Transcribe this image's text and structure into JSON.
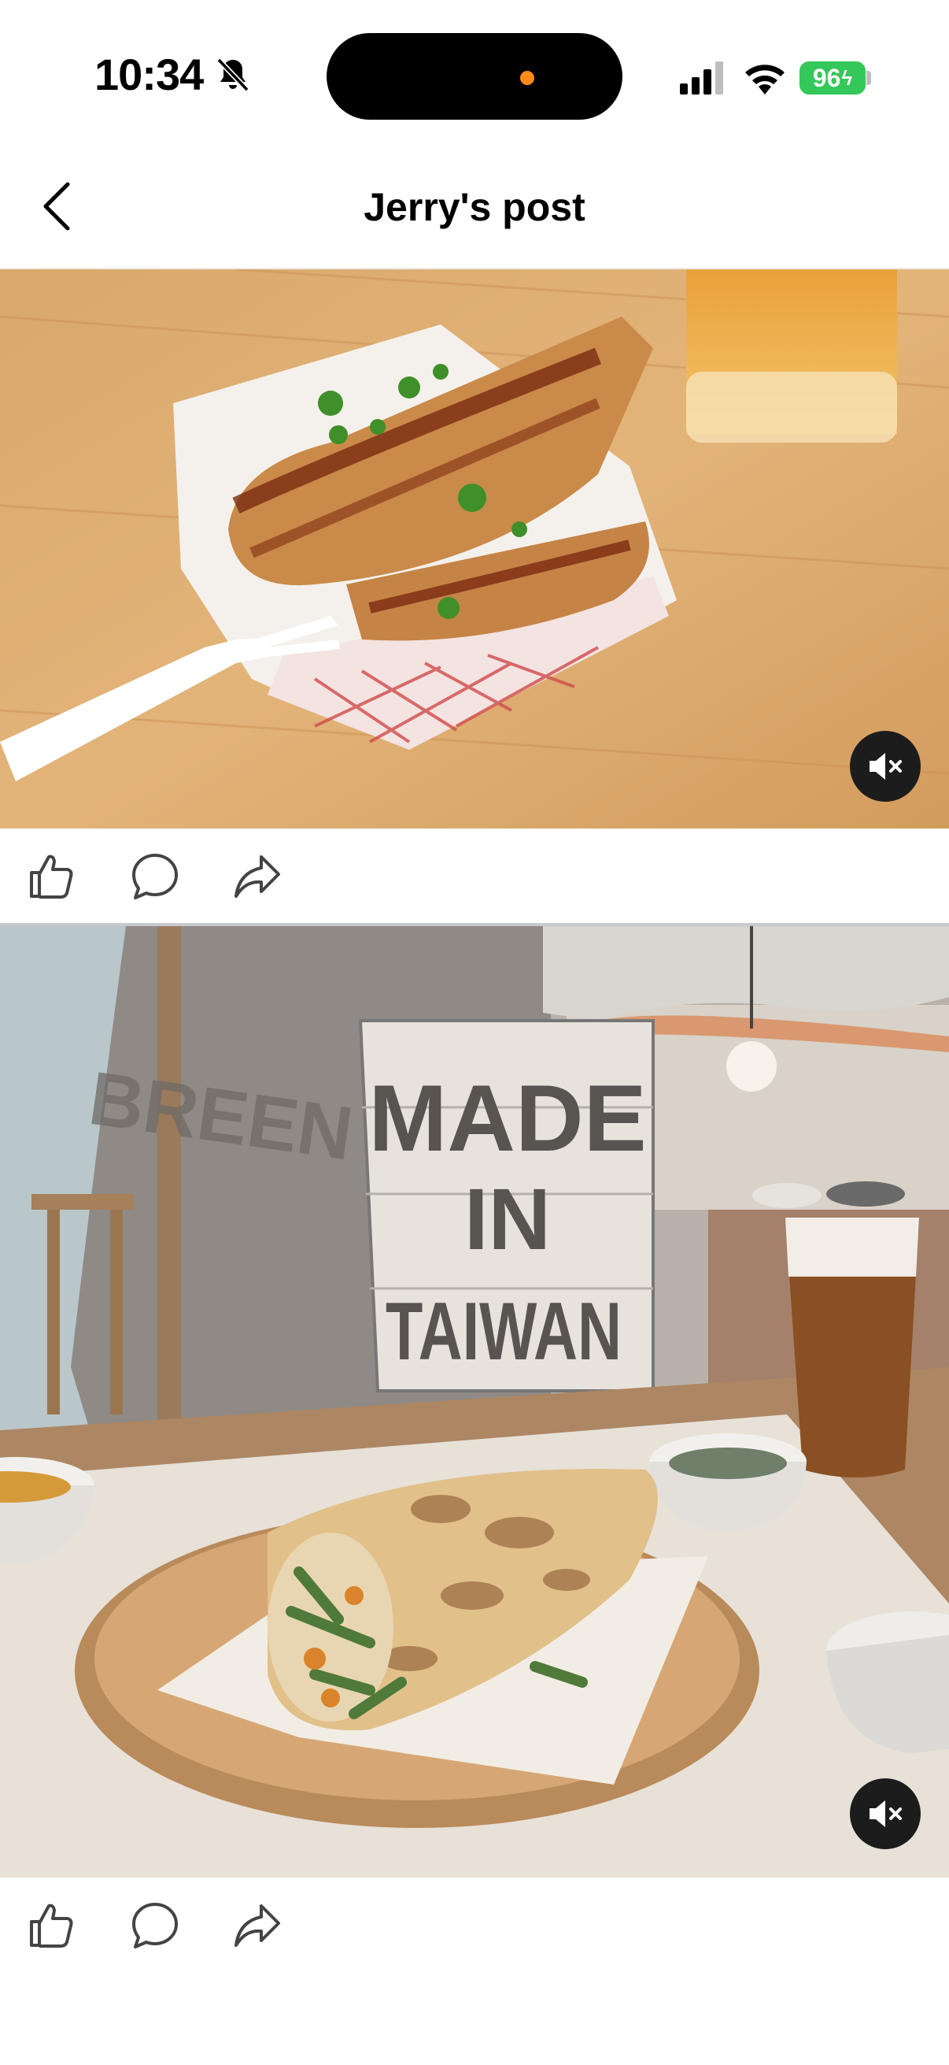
{
  "status_bar": {
    "time": "10:34",
    "battery": "96",
    "icons": [
      "bell-slash-icon",
      "signal-icon",
      "wifi-icon",
      "battery-charging-icon"
    ],
    "battery_color": "#34c759",
    "island_dot_color": "#ff8c1a"
  },
  "header": {
    "title": "Jerry's post",
    "back_icon": "chevron-left-icon"
  },
  "posts": [
    {
      "media_type": "photo",
      "image_description_icon": "food-photo",
      "scene": {
        "sign_text": ""
      },
      "mute_icon": "speaker-muted-icon",
      "actions": [
        "like-icon",
        "comment-icon",
        "share-icon"
      ]
    },
    {
      "media_type": "illustration",
      "scene": {
        "sign_text_1": "MADE",
        "sign_text_2": "IN",
        "sign_text_3": "TAIWAN",
        "wall_text": "BREEN"
      },
      "mute_icon": "speaker-muted-icon",
      "actions": [
        "like-icon",
        "comment-icon",
        "share-icon"
      ]
    }
  ],
  "colors": {
    "text": "#000000",
    "mute_bg": "#1c1c1c",
    "divider": "#c8c8d0"
  }
}
